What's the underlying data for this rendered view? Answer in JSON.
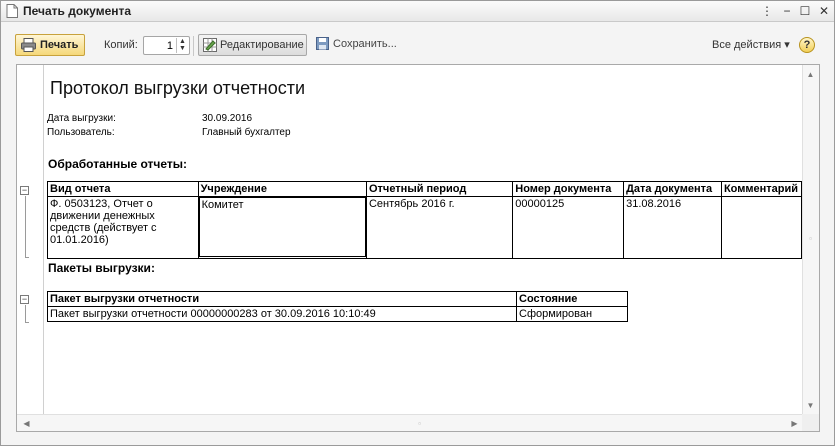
{
  "window": {
    "title": "Печать документа",
    "controls": [
      "⋮",
      "−",
      "☐",
      "✕"
    ]
  },
  "toolbar": {
    "print_label": "Печать",
    "copies_label": "Копий:",
    "copies_value": "1",
    "edit_label": "Редактирование",
    "save_label": "Сохранить...",
    "all_actions_label": "Все действия ▾",
    "help_label": "?"
  },
  "document": {
    "title": "Протокол выгрузки отчетности",
    "meta": [
      {
        "label": "Дата выгрузки:",
        "value": "30.09.2016"
      },
      {
        "label": "Пользователь:",
        "value": "Главный бухгалтер"
      }
    ],
    "processed_heading": "Обработанные отчеты:",
    "reports_table": {
      "headers": [
        "Вид отчета",
        "Учреждение",
        "Отчетный период",
        "Номер документа",
        "Дата документа",
        "Комментарий"
      ],
      "rows": [
        [
          "Ф. 0503123, Отчет о движении денежных средств (действует с 01.01.2016)",
          "Комитет",
          "Сентябрь 2016 г.",
          "00000125",
          "31.08.2016",
          ""
        ]
      ]
    },
    "packages_heading": "Пакеты выгрузки:",
    "packages_table": {
      "headers": [
        "Пакет выгрузки отчетности",
        "Состояние"
      ],
      "rows": [
        [
          "Пакет выгрузки отчетности 00000000283 от 30.09.2016 10:10:49",
          "Сформирован"
        ]
      ]
    }
  }
}
